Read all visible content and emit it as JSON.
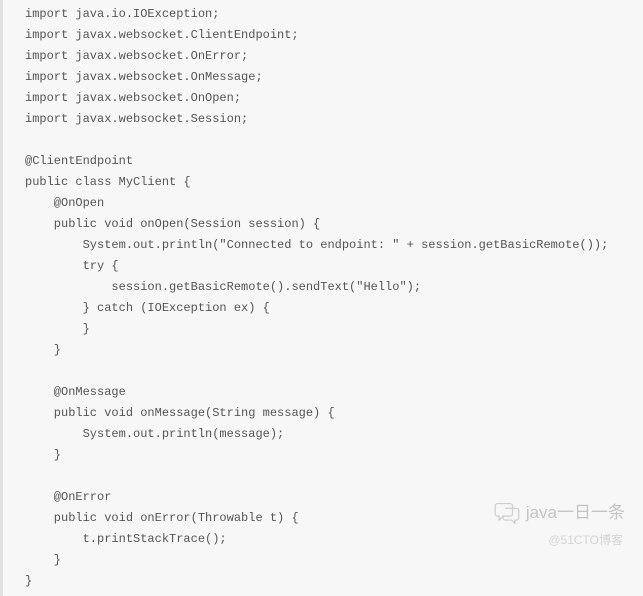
{
  "code": {
    "lines": [
      "import java.io.IOException;",
      "import javax.websocket.ClientEndpoint;",
      "import javax.websocket.OnError;",
      "import javax.websocket.OnMessage;",
      "import javax.websocket.OnOpen;",
      "import javax.websocket.Session;",
      "",
      "@ClientEndpoint",
      "public class MyClient {",
      "    @OnOpen",
      "    public void onOpen(Session session) {",
      "        System.out.println(\"Connected to endpoint: \" + session.getBasicRemote());",
      "        try {",
      "            session.getBasicRemote().sendText(\"Hello\");",
      "        } catch (IOException ex) {",
      "        }",
      "    }",
      "",
      "    @OnMessage",
      "    public void onMessage(String message) {",
      "        System.out.println(message);",
      "    }",
      "",
      "    @OnError",
      "    public void onError(Throwable t) {",
      "        t.printStackTrace();",
      "    }",
      "}"
    ]
  },
  "watermark": {
    "title": "java一日一条",
    "subtitle": "@51CTO博客"
  }
}
